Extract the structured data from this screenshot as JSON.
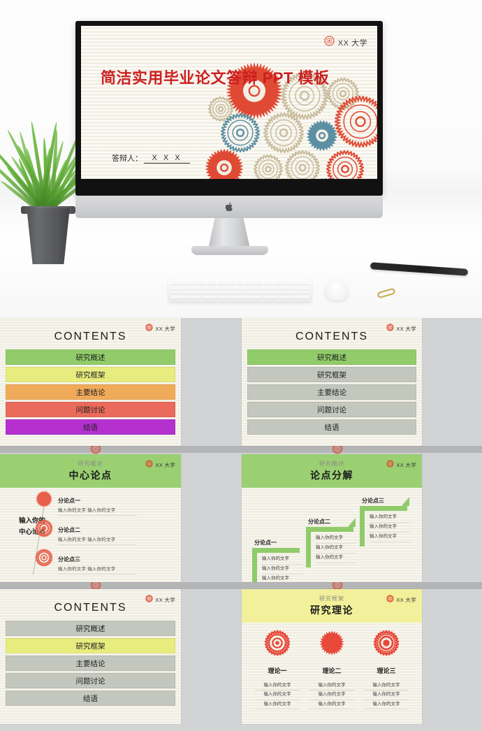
{
  "brand": {
    "university": "XX 大学",
    "logo_icon": "gear-logo-icon",
    "accent_red": "#e04a34",
    "paper_bg": "#f1eee3",
    "deck_gray": "#d2d3d5"
  },
  "hero": {
    "device": "imac-desktop-computer",
    "apple_logo_icon": "apple-logo-icon",
    "desk_items": [
      "potted-grass-plant",
      "keyboard",
      "mouse",
      "pen",
      "paper-clip"
    ],
    "slide": {
      "logo_label": "XX 大学",
      "title": "简洁实用毕业论文答辩 PPT 模板",
      "presenter_label": "答辩人：",
      "presenter_value": "X X X",
      "decoration": "gear-cluster-illustration"
    }
  },
  "slides": [
    {
      "id": "contents-colored",
      "kind": "contents",
      "logo_label": "XX 大学",
      "heading": "CONTENTS",
      "items": [
        {
          "label": "研究概述",
          "color": "#92cc6a"
        },
        {
          "label": "研究框架",
          "color": "#e7ec7e"
        },
        {
          "label": "主要结论",
          "color": "#f0ab5a"
        },
        {
          "label": "问题讨论",
          "color": "#ea6a5c"
        },
        {
          "label": "结语",
          "color": "#b431cf"
        }
      ]
    },
    {
      "id": "contents-highlight-1",
      "kind": "contents",
      "logo_label": "XX 大学",
      "heading": "CONTENTS",
      "items": [
        {
          "label": "研究概述",
          "color": "#92cc6a",
          "active": true
        },
        {
          "label": "研究框架",
          "color": "#c3c7bd"
        },
        {
          "label": "主要结论",
          "color": "#c3c7bd"
        },
        {
          "label": "问题讨论",
          "color": "#c3c7bd"
        },
        {
          "label": "结语",
          "color": "#c3c7bd"
        }
      ]
    },
    {
      "id": "central-argument",
      "kind": "central",
      "logo_label": "XX 大学",
      "header_color": "#9ad072",
      "kicker": "研究概述",
      "title": "中心论点",
      "center_label": "输入你的\n中心论点",
      "center_label_line1": "输入你的",
      "center_label_line2": "中心论点",
      "nodes": [
        {
          "title": "分论点一",
          "desc": "输入你的文字  输入你的文字",
          "icon": "gear-icon"
        },
        {
          "title": "分论点二",
          "desc": "输入你的文字  输入你的文字",
          "icon": "gear-icon"
        },
        {
          "title": "分论点三",
          "desc": "输入你的文字  输入你的文字",
          "icon": "gear-icon"
        }
      ]
    },
    {
      "id": "argument-decomposition",
      "kind": "steps",
      "logo_label": "XX 大学",
      "header_color": "#9ad072",
      "kicker": "研究概述",
      "title": "论点分解",
      "steps": [
        {
          "label": "分论点一",
          "lines": [
            "输入你的文字",
            "输入你的文字",
            "输入你的文字"
          ]
        },
        {
          "label": "分论点二",
          "lines": [
            "输入你的文字",
            "输入你的文字",
            "输入你的文字"
          ]
        },
        {
          "label": "分论点三",
          "lines": [
            "输入你的文字",
            "输入你的文字",
            "输入你的文字"
          ]
        }
      ]
    },
    {
      "id": "contents-highlight-2",
      "kind": "contents",
      "logo_label": "XX 大学",
      "heading": "CONTENTS",
      "items": [
        {
          "label": "研究概述",
          "color": "#c3c7bd"
        },
        {
          "label": "研究框架",
          "color": "#e7ec7e",
          "active": true
        },
        {
          "label": "主要结论",
          "color": "#c3c7bd"
        },
        {
          "label": "问题讨论",
          "color": "#c3c7bd"
        },
        {
          "label": "结语",
          "color": "#c3c7bd"
        }
      ]
    },
    {
      "id": "research-theory",
      "kind": "theory",
      "logo_label": "XX 大学",
      "header_color": "#f2f09a",
      "kicker": "研究框架",
      "title": "研究理论",
      "columns": [
        {
          "name": "理论一",
          "icon": "gear-ring-icon",
          "lines": [
            "输入你的文字",
            "输入你的文字",
            "输入你的文字"
          ]
        },
        {
          "name": "理论二",
          "icon": "gear-solid-icon",
          "lines": [
            "输入你的文字",
            "输入你的文字",
            "输入你的文字"
          ]
        },
        {
          "name": "理论三",
          "icon": "gear-radial-icon",
          "lines": [
            "输入你的文字",
            "输入你的文字",
            "输入你的文字"
          ]
        }
      ]
    }
  ]
}
